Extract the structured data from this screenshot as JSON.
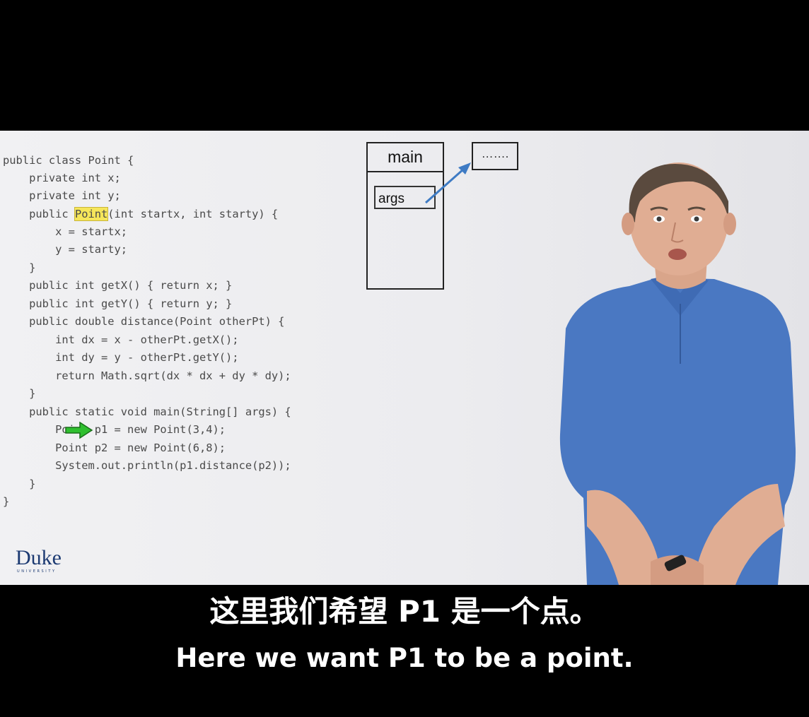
{
  "code": {
    "lines": [
      "public class Point {",
      "    private int x;",
      "    private int y;",
      "    public ",
      "        x = startx;",
      "        y = starty;",
      "    }",
      "    public int getX() { return x; }",
      "    public int getY() { return y; }",
      "    public double distance(Point otherPt) {",
      "        int dx = x - otherPt.getX();",
      "        int dy = y - otherPt.getY();",
      "        return Math.sqrt(dx * dx + dy * dy);",
      "    }",
      "    public static void main(String[] args) {",
      "        Point p1 = new Point(3,4);",
      "        Point p2 = new Point(6,8);",
      "        System.out.println(p1.distance(p2));",
      "    }",
      "}"
    ],
    "highlighted_word": "Point",
    "highlight_line_suffix": "(int startx, int starty) {",
    "current_line_index": 15,
    "highlight_color": "#f6e65a",
    "arrow_color": "#2fbf2f"
  },
  "memory": {
    "frame_label": "main",
    "variable_label": "args",
    "object_label": "……."
  },
  "logo": {
    "word": "Duke",
    "sub": "UNIVERSITY"
  },
  "subtitles": {
    "zh": "这里我们希望 P1 是一个点。",
    "en": "Here we want P1 to be a point."
  }
}
